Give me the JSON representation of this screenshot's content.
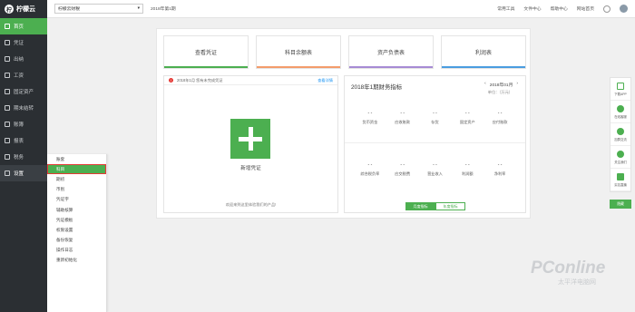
{
  "app": {
    "logo_text": "柠檬云",
    "logo_mark": "柠"
  },
  "sidebar": {
    "items": [
      {
        "label": "首页",
        "icon": "home-icon"
      },
      {
        "label": "凭证",
        "icon": "voucher-icon"
      },
      {
        "label": "出纳",
        "icon": "cashier-icon"
      },
      {
        "label": "工资",
        "icon": "salary-icon"
      },
      {
        "label": "固定资产",
        "icon": "asset-icon"
      },
      {
        "label": "期末结转",
        "icon": "closing-icon"
      },
      {
        "label": "账簿",
        "icon": "ledger-icon"
      },
      {
        "label": "报表",
        "icon": "report-icon"
      },
      {
        "label": "税务",
        "icon": "tax-icon"
      },
      {
        "label": "设置",
        "icon": "gear-icon"
      }
    ]
  },
  "submenu": {
    "items": [
      "账套",
      "科目",
      "期初",
      "币别",
      "凭证字",
      "辅助核算",
      "凭证模板",
      "权限设置",
      "备份恢复",
      "操作日志",
      "重新初始化"
    ]
  },
  "topbar": {
    "company": "柠檬云财税",
    "period": "2018年第1期",
    "links": [
      "常用工具",
      "文件中心",
      "帮助中心",
      "网站首页"
    ]
  },
  "cards": [
    {
      "label": "查看凭证",
      "color": "#4caf50"
    },
    {
      "label": "科目余额表",
      "color": "#f39c6b"
    },
    {
      "label": "资产负债表",
      "color": "#a78bd4"
    },
    {
      "label": "利润表",
      "color": "#4a9de0"
    }
  ],
  "notice": {
    "text": "2018年1月 您有未完成凭证",
    "detail": "查看详情"
  },
  "new_voucher": {
    "label": "新增凭证"
  },
  "welcome": "欢迎来到这里体验我们的产品!",
  "finance": {
    "title": "2018年1期财务指标",
    "date": "2018年01月",
    "prev": "‹",
    "next": "›",
    "unit": "单位：（万元）",
    "row1": [
      {
        "value": "- -",
        "label": "货币资金"
      },
      {
        "value": "- -",
        "label": "应收账款"
      },
      {
        "value": "- -",
        "label": "存货"
      },
      {
        "value": "- -",
        "label": "固定资产"
      },
      {
        "value": "- -",
        "label": "应付账款"
      }
    ],
    "row2": [
      {
        "value": "- -",
        "label": "综合税负率"
      },
      {
        "value": "- -",
        "label": "应交税费"
      },
      {
        "value": "- -",
        "label": "营业收入"
      },
      {
        "value": "- -",
        "label": "利润额"
      },
      {
        "value": "- -",
        "label": "净利率"
      }
    ],
    "toggle_on": "月度指标",
    "toggle_off": "年度指标"
  },
  "float": [
    {
      "label": "下载APP",
      "color": "#4caf50"
    },
    {
      "label": "在线客服",
      "color": "#4caf50"
    },
    {
      "label": "加群交流",
      "color": "#4caf50"
    },
    {
      "label": "关注我们",
      "color": "#4caf50"
    },
    {
      "label": "实名直播",
      "color": "#4caf50"
    }
  ],
  "back_label": "隐藏",
  "watermark": {
    "main": "PConline",
    "sub": "太平洋电脑网"
  }
}
